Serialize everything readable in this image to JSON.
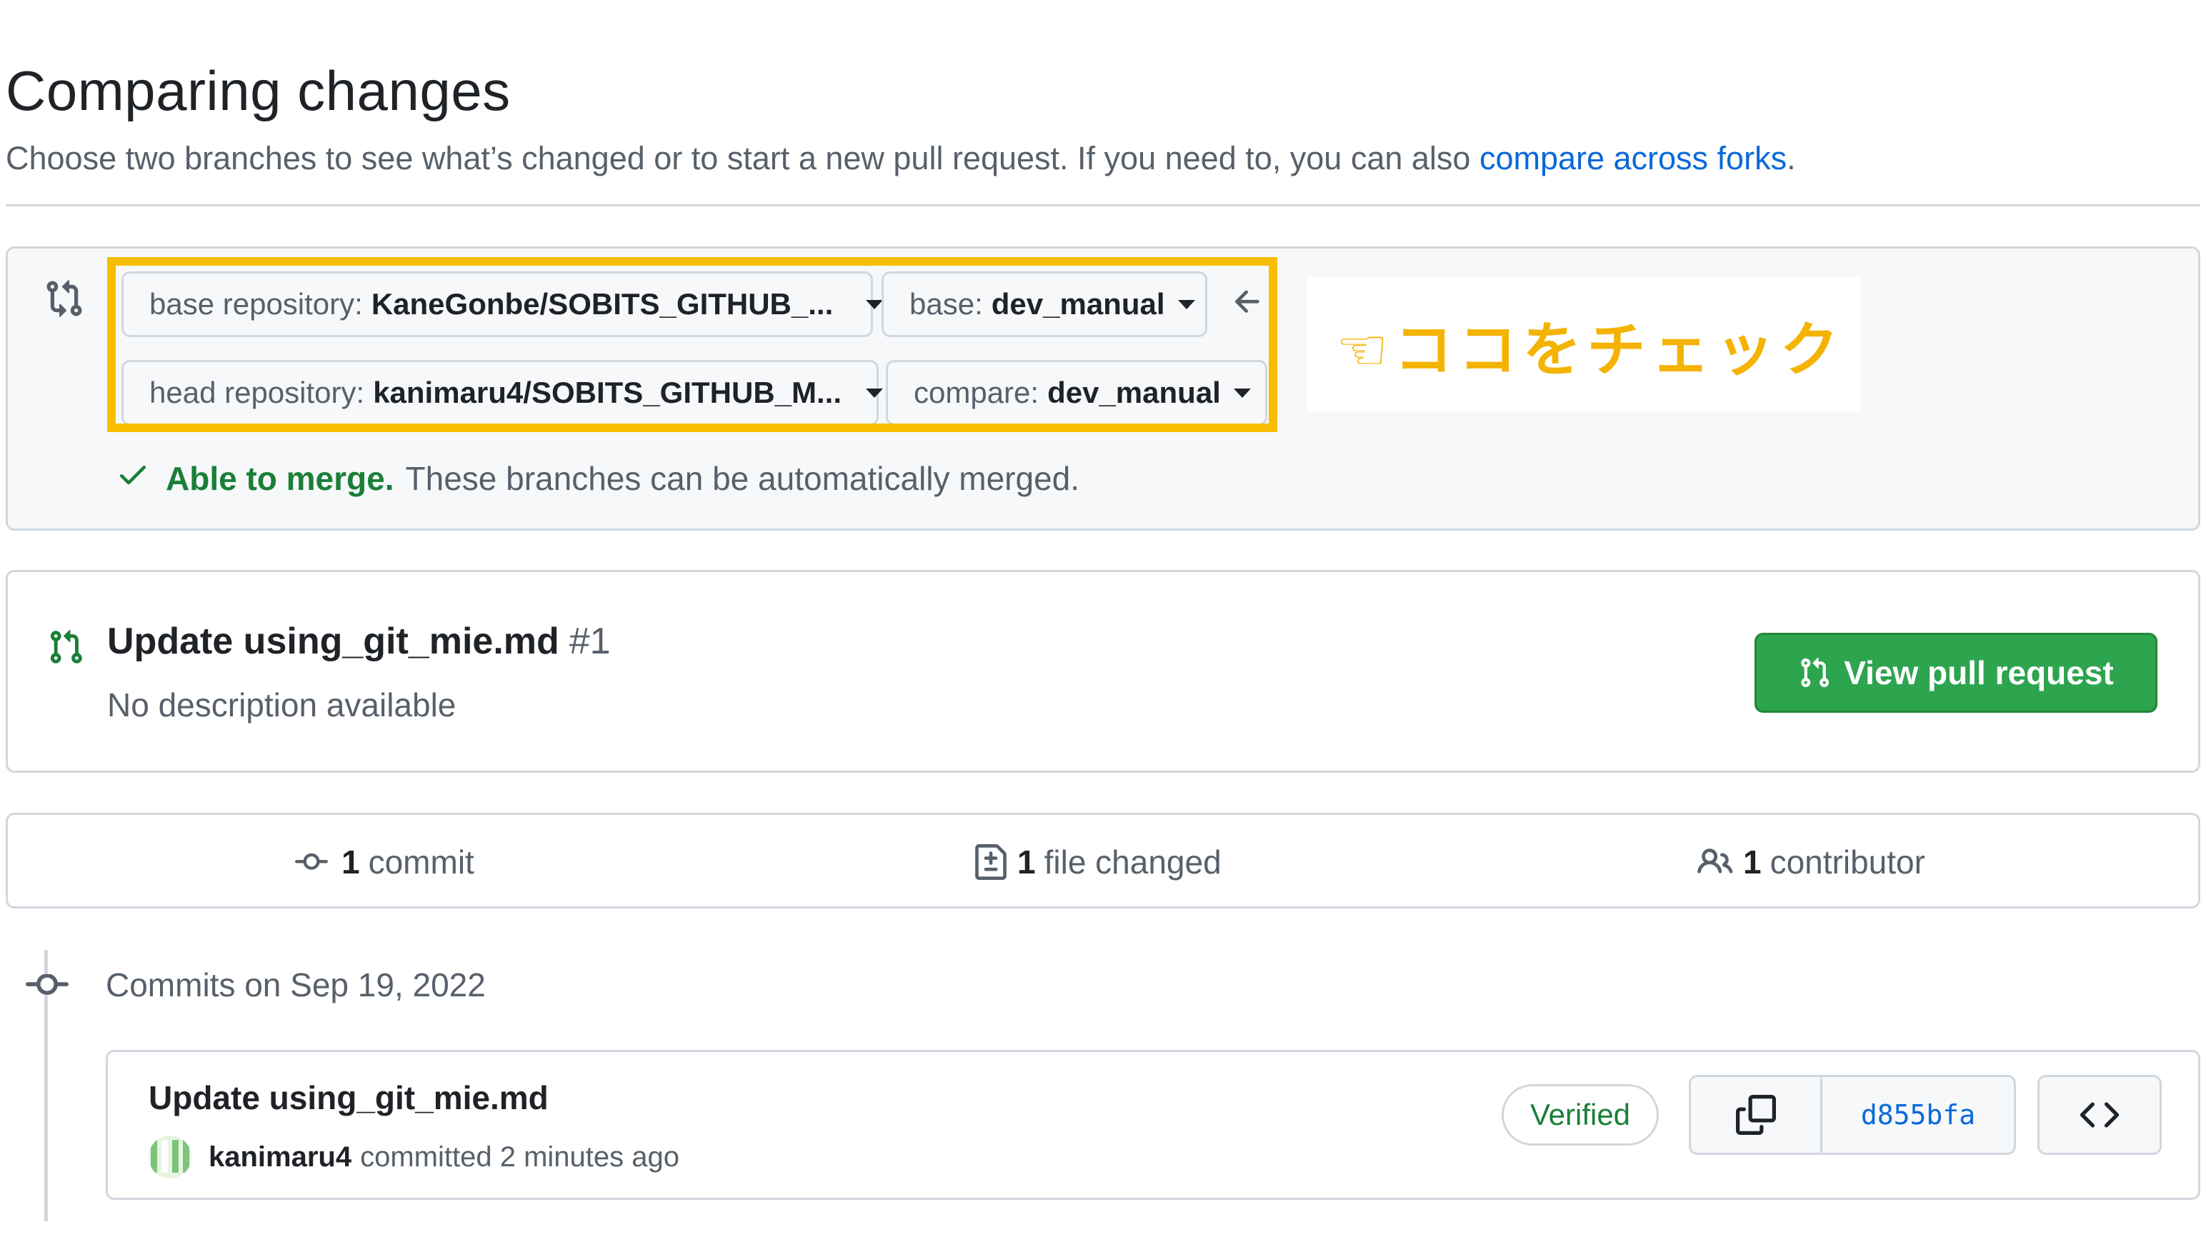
{
  "header": {
    "title": "Comparing changes",
    "subtitle": "Choose two branches to see what’s changed or to start a new pull request. If you need to, you can also ",
    "subtitle_link": "compare across forks",
    "subtitle_end": "."
  },
  "range": {
    "base_repo_label": "base repository:",
    "base_repo_value": "KaneGonbe/SOBITS_GITHUB_...",
    "base_label": "base:",
    "base_value": "dev_manual",
    "head_repo_label": "head repository:",
    "head_repo_value": "kanimaru4/SOBITS_GITHUB_M...",
    "compare_label": "compare:",
    "compare_value": "dev_manual",
    "merge_status": "Able to merge.",
    "merge_detail": "These branches can be automatically merged."
  },
  "annotation": {
    "text": "☜ココをチェック",
    "color": "#f3b300",
    "highlight_color": "#f7bd00"
  },
  "pull_request": {
    "title": "Update using_git_mie.md",
    "number": "#1",
    "description": "No description available",
    "view_button": "View pull request",
    "button_color": "#2da44e"
  },
  "stats": {
    "commits_count": "1",
    "commits_label": "commit",
    "files_count": "1",
    "files_label": "file changed",
    "contributors_count": "1",
    "contributors_label": "contributor"
  },
  "commits": {
    "heading": "Commits on Sep 19, 2022",
    "items": [
      {
        "title": "Update using_git_mie.md",
        "author": "kanimaru4",
        "action": "committed 2 minutes ago",
        "badge": "Verified",
        "sha": "d855bfa"
      }
    ]
  },
  "icons": [
    "git-compare-icon",
    "arrow-left-icon",
    "check-icon",
    "git-pull-request-icon",
    "git-commit-icon",
    "file-diff-icon",
    "people-icon",
    "copy-icon",
    "code-icon"
  ]
}
